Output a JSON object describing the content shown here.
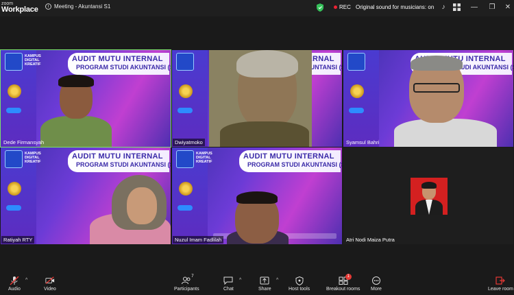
{
  "app": {
    "brand_top": "zoom",
    "brand_bottom": "Workplace"
  },
  "window": {
    "title": "Meeting - Akuntansi S1"
  },
  "status": {
    "rec": "REC",
    "original_sound": "Original sound for musicians: on"
  },
  "slide": {
    "title_line1": "AUDIT MUTU INTERNAL",
    "title_line2": "PROGRAM STUDI AKUNTANSI (S1)",
    "logo_text": "KAMPUS DIGITAL KREATIF"
  },
  "participants": [
    {
      "name": "Dede Firmansyah",
      "active": true
    },
    {
      "name": "Dwiyatmoko"
    },
    {
      "name": "Syamsul Bahri"
    },
    {
      "name": "Ratiyah RTY"
    },
    {
      "name": "Nuzul Imam Fadlilah"
    },
    {
      "name": "Atri Nodi Maiza Putra"
    }
  ],
  "toolbar": {
    "audio": "Audio",
    "video": "Video",
    "participants": "Participants",
    "participants_count": "7",
    "chat": "Chat",
    "share": "Share",
    "host_tools": "Host tools",
    "breakout_rooms": "Breakout rooms",
    "breakout_badge": "1",
    "more": "More",
    "leave": "Leave room"
  },
  "colors": {
    "accent_green": "#7be36b",
    "leave_red": "#e53935",
    "zoom_blue": "#2d8cff"
  }
}
